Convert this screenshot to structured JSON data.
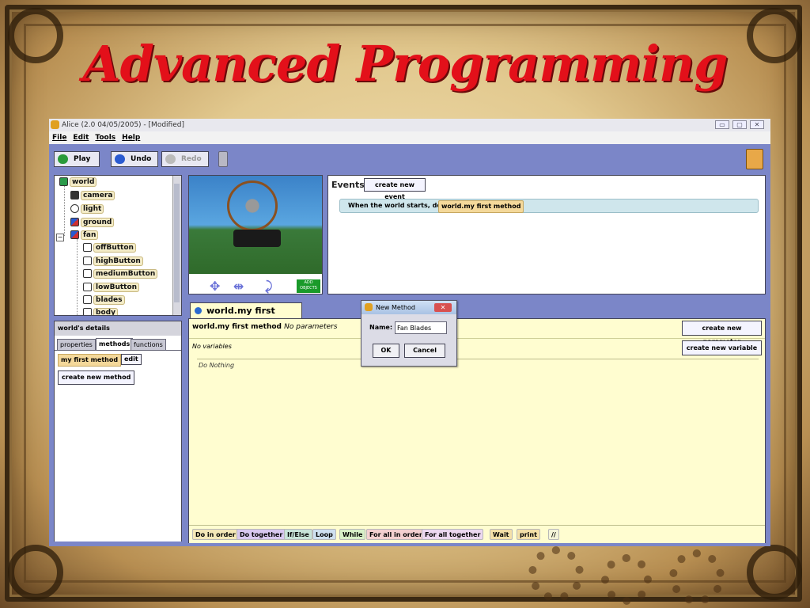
{
  "slide": {
    "title": "Advanced Programming"
  },
  "window": {
    "title": "Alice (2.0 04/05/2005) - [Modified]",
    "controls": [
      "▭",
      "▢",
      "✕"
    ]
  },
  "menu": {
    "items": [
      "File",
      "Edit",
      "Tools",
      "Help"
    ]
  },
  "toolbar": {
    "play": "Play",
    "undo": "Undo",
    "redo": "Redo"
  },
  "tree": {
    "items": [
      {
        "label": "world",
        "icon": "globe-icon"
      },
      {
        "label": "camera",
        "icon": "camera-icon"
      },
      {
        "label": "light",
        "icon": "lightbulb-icon"
      },
      {
        "label": "ground",
        "icon": "object-icon"
      },
      {
        "label": "fan",
        "icon": "object-icon"
      },
      {
        "label": "offButton",
        "icon": "part-icon"
      },
      {
        "label": "highButton",
        "icon": "part-icon"
      },
      {
        "label": "mediumButton",
        "icon": "part-icon"
      },
      {
        "label": "lowButton",
        "icon": "part-icon"
      },
      {
        "label": "blades",
        "icon": "part-icon"
      },
      {
        "label": "body",
        "icon": "part-icon"
      }
    ]
  },
  "scene": {
    "add_objects_line1": "ADD",
    "add_objects_line2": "OBJECTS"
  },
  "events": {
    "label": "Events",
    "create_button": "create new event",
    "when_text": "When the world starts,",
    "do_text": "do",
    "method": "world.my first method"
  },
  "details": {
    "header": "world's details",
    "tabs": [
      "properties",
      "methods",
      "functions"
    ],
    "active_tab": "methods",
    "method_item": "my first method",
    "edit_button": "edit",
    "create_method_button": "create new method"
  },
  "editor": {
    "tab_label": "world.my first method",
    "signature": "world.my first method",
    "params": "No parameters",
    "variables": "No variables",
    "create_param_button": "create new parameter",
    "create_var_button": "create new variable",
    "body": "Do Nothing",
    "controls": [
      {
        "label": "Do in order",
        "color": "#f4e8b8"
      },
      {
        "label": "Do together",
        "color": "#d8c8f0"
      },
      {
        "label": "If/Else",
        "color": "#c8e4d8"
      },
      {
        "label": "Loop",
        "color": "#cfe0f0"
      },
      {
        "label": "While",
        "color": "#d8f0c8"
      },
      {
        "label": "For all in order",
        "color": "#f4d0d0"
      },
      {
        "label": "For all together",
        "color": "#ecd8f0"
      },
      {
        "label": "Wait",
        "color": "#f4e0a8"
      },
      {
        "label": "print",
        "color": "#f4e0a8"
      },
      {
        "label": "//",
        "color": "#f4f4d8"
      }
    ]
  },
  "dialog": {
    "title": "New Method",
    "close": "✕",
    "name_label": "Name:",
    "name_value": "Fan Blades",
    "ok": "OK",
    "cancel": "Cancel"
  }
}
